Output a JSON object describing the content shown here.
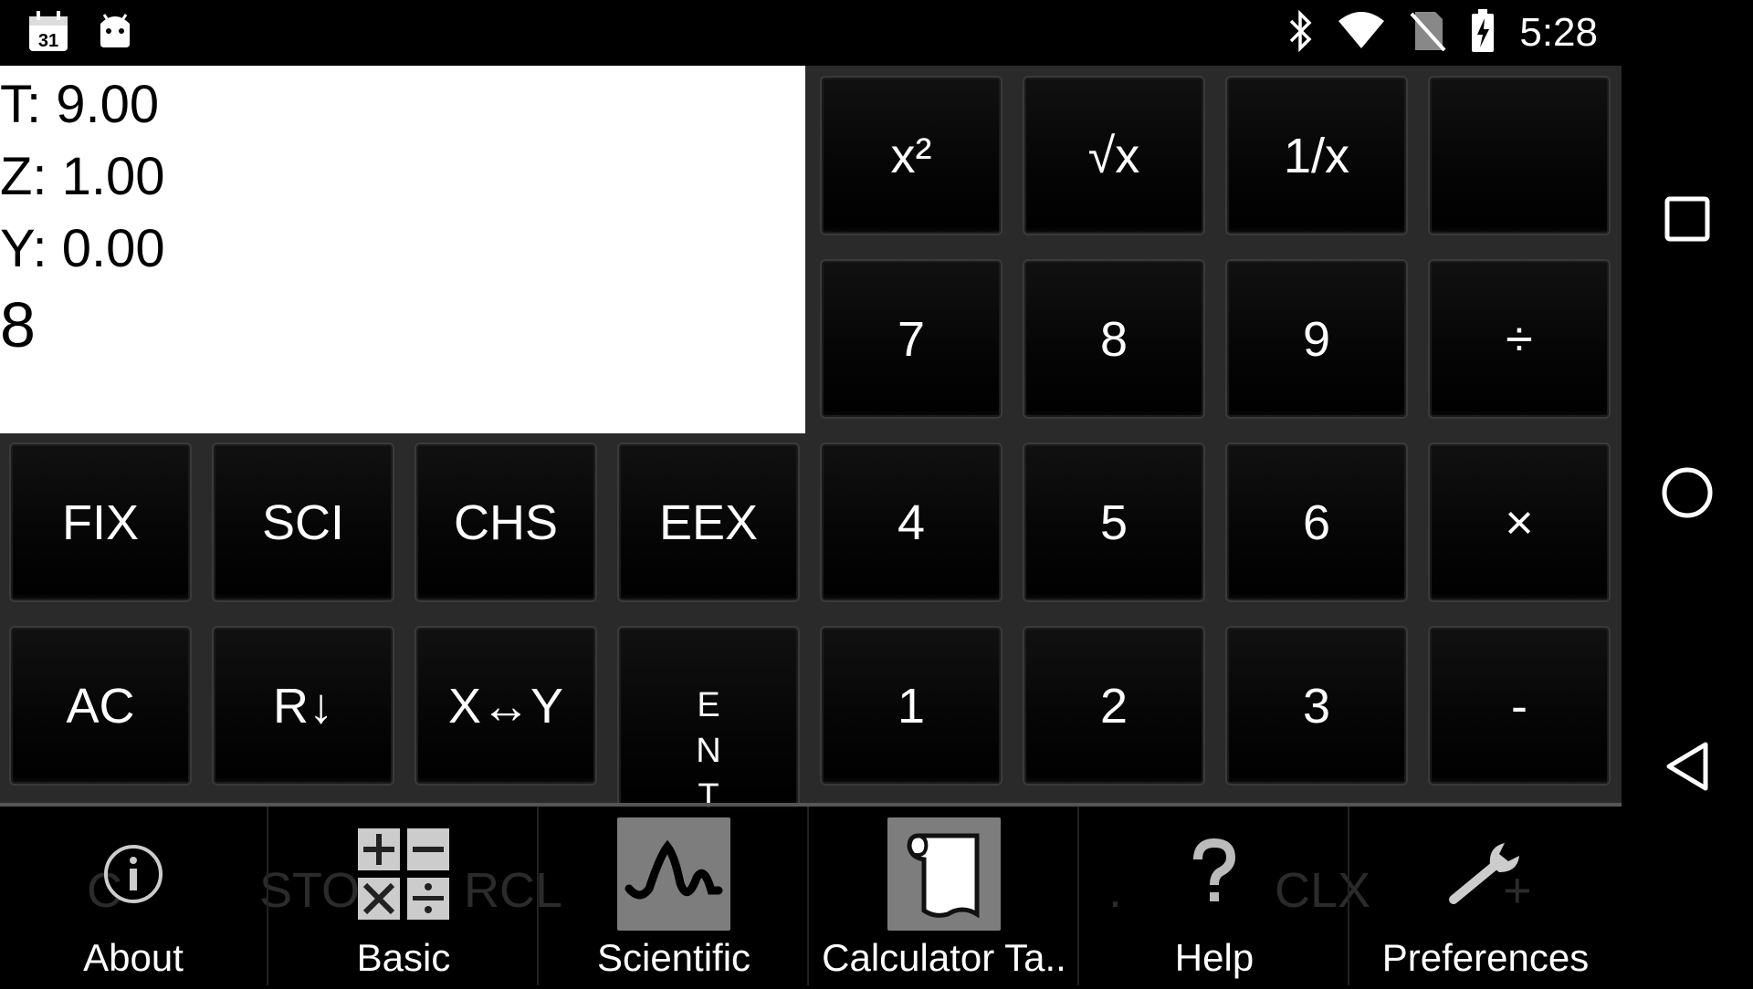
{
  "status_bar": {
    "time": "5:28",
    "left_icons": [
      "calendar-icon",
      "android-icon"
    ],
    "right_icons": [
      "bluetooth-icon",
      "wifi-icon",
      "no-sim-icon",
      "battery-charging-icon"
    ],
    "calendar_day": "31"
  },
  "display": {
    "t": "T: 9.00",
    "z": "Z: 1.00",
    "y": "Y: 0.00",
    "x": "8"
  },
  "keys": {
    "square": "x²",
    "sqrt": "√x",
    "reciprocal": "1/x",
    "blank": "",
    "seven": "7",
    "eight": "8",
    "nine": "9",
    "divide": "÷",
    "fix": "FIX",
    "sci": "SCI",
    "chs": "CHS",
    "eex": "EEX",
    "four": "4",
    "five": "5",
    "six": "6",
    "multiply": "×",
    "ac": "AC",
    "roll_down": "R↓",
    "swap": "X↔Y",
    "enter_letters": [
      "E",
      "N",
      "T"
    ],
    "one": "1",
    "two": "2",
    "three": "3",
    "minus": "-"
  },
  "ghost_keys": {
    "c": "C",
    "sto": "STO",
    "rcl": "RCL",
    "dot": ".",
    "clx": "CLX",
    "plus": "+"
  },
  "menu": {
    "items": [
      {
        "label": "About",
        "icon": "info-icon"
      },
      {
        "label": "Basic",
        "icon": "basic-ops-icon"
      },
      {
        "label": "Scientific",
        "icon": "waveform-icon"
      },
      {
        "label": "Calculator Ta..",
        "icon": "paper-tape-icon"
      },
      {
        "label": "Help",
        "icon": "question-icon"
      },
      {
        "label": "Preferences",
        "icon": "wrench-icon"
      }
    ]
  },
  "colors": {
    "display_bg": "#ffffff",
    "keypad_bg": "#2a2a2a",
    "key_bg": "#000000",
    "selected_menu_icon_bg": "#7d7d7d"
  }
}
